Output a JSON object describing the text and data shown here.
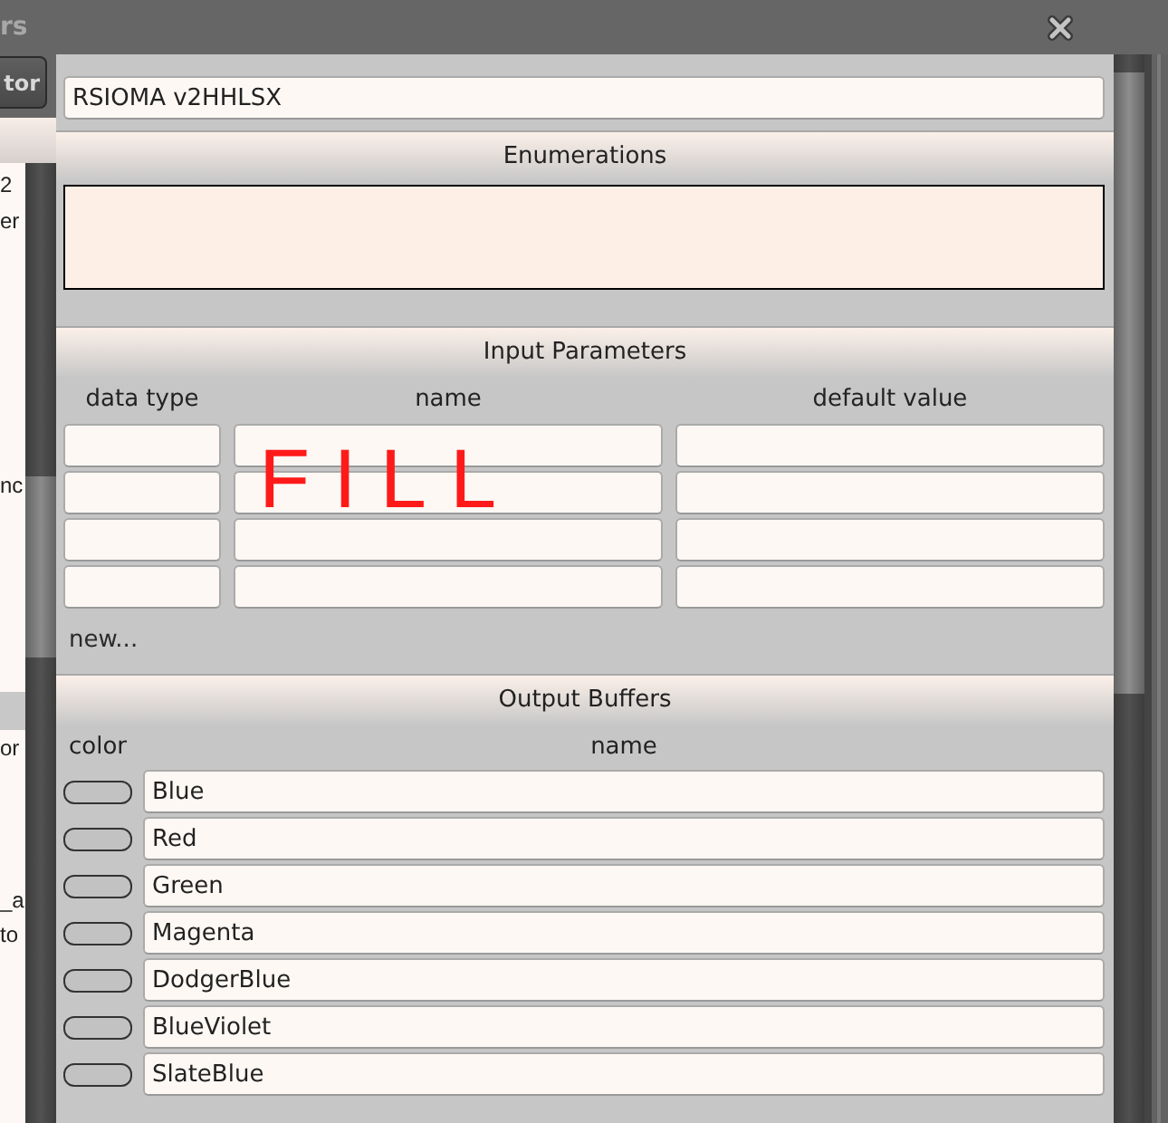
{
  "window": {
    "title": "rs"
  },
  "side_panel": {
    "button": "tor",
    "upper_items": [
      "2",
      "er",
      "nc"
    ],
    "lower_items": [
      "or",
      "_a",
      "to"
    ]
  },
  "editor": {
    "name_field": {
      "value": "RSIOMA v2HHLSX"
    },
    "enumerations": {
      "title": "Enumerations"
    },
    "input_parameters": {
      "title": "Input Parameters",
      "columns": [
        "data type",
        "name",
        "default value"
      ],
      "rows": [
        {
          "kind": "blank"
        },
        {
          "kind": "blank"
        },
        {
          "kind": "blank"
        },
        {
          "kind": "blank"
        }
      ],
      "new_link": "new...",
      "annotation": "FILL"
    },
    "output_buffers": {
      "title": "Output Buffers",
      "columns": [
        "color",
        "name"
      ],
      "rows": [
        {
          "name": "Blue"
        },
        {
          "name": "Red"
        },
        {
          "name": "Green"
        },
        {
          "name": "Magenta"
        },
        {
          "name": "DodgerBlue"
        },
        {
          "name": "BlueViolet"
        },
        {
          "name": "SlateBlue"
        }
      ]
    }
  }
}
